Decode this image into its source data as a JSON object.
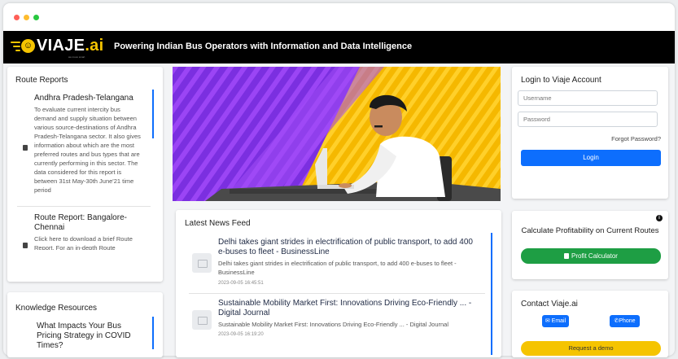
{
  "header": {
    "logo_text": "VIAJE",
    "logo_ai": ".ai",
    "logo_tagline": "we move smart",
    "tagline": "Powering Indian Bus Operators with Information and Data Intelligence"
  },
  "route_reports": {
    "title": "Route Reports",
    "items": [
      {
        "title": "Andhra Pradesh-Telangana",
        "description": "To evaluate current intercity bus demand and supply situation between various source-destinations of Andhra Pradesh-Telangana sector. It also gives information about which are the most preferred routes and bus types that are currently performing in this sector. The data considered for this report is between 31st May-30th June'21 time period"
      },
      {
        "title": "Route Report: Bangalore-Chennai",
        "description": "Click here to download a brief Route Report. For an in-depth Route"
      }
    ]
  },
  "knowledge": {
    "title": "Knowledge Resources",
    "items": [
      {
        "title": "What Impacts Your Bus Pricing Strategy in COVID Times?"
      }
    ]
  },
  "news": {
    "title": "Latest News Feed",
    "items": [
      {
        "title": "Delhi takes giant strides in electrification of public transport, to add 400 e-buses to fleet - BusinessLine",
        "snippet": "Delhi takes giant strides in electrification of public transport, to add 400 e-buses to fleet - BusinessLine",
        "date": "2023-09-05 16:45:51"
      },
      {
        "title": "Sustainable Mobility Market First: Innovations Driving Eco-Friendly ... - Digital Journal",
        "snippet": "Sustainable Mobility Market First: Innovations Driving Eco-Friendly ... - Digital Journal",
        "date": "2023-09-05 16:19:20"
      }
    ]
  },
  "login": {
    "title": "Login to Viaje Account",
    "username_placeholder": "Username",
    "password_placeholder": "Password",
    "forgot_label": "Forgot Password?",
    "login_label": "Login"
  },
  "profit": {
    "title": "Calculate Profitability on Current Routes",
    "button_label": "Profit Calculator",
    "info_icon": "info-icon"
  },
  "contact": {
    "title": "Contact Viaje.ai",
    "email_label": "Email",
    "phone_label": "Phone",
    "demo_label": "Request a demo"
  },
  "colors": {
    "header_bg": "#000000",
    "brand_yellow": "#f5c400",
    "primary_blue": "#0d6efd",
    "success_green": "#1e9e44",
    "hero_purple": "#7b2fe0"
  }
}
